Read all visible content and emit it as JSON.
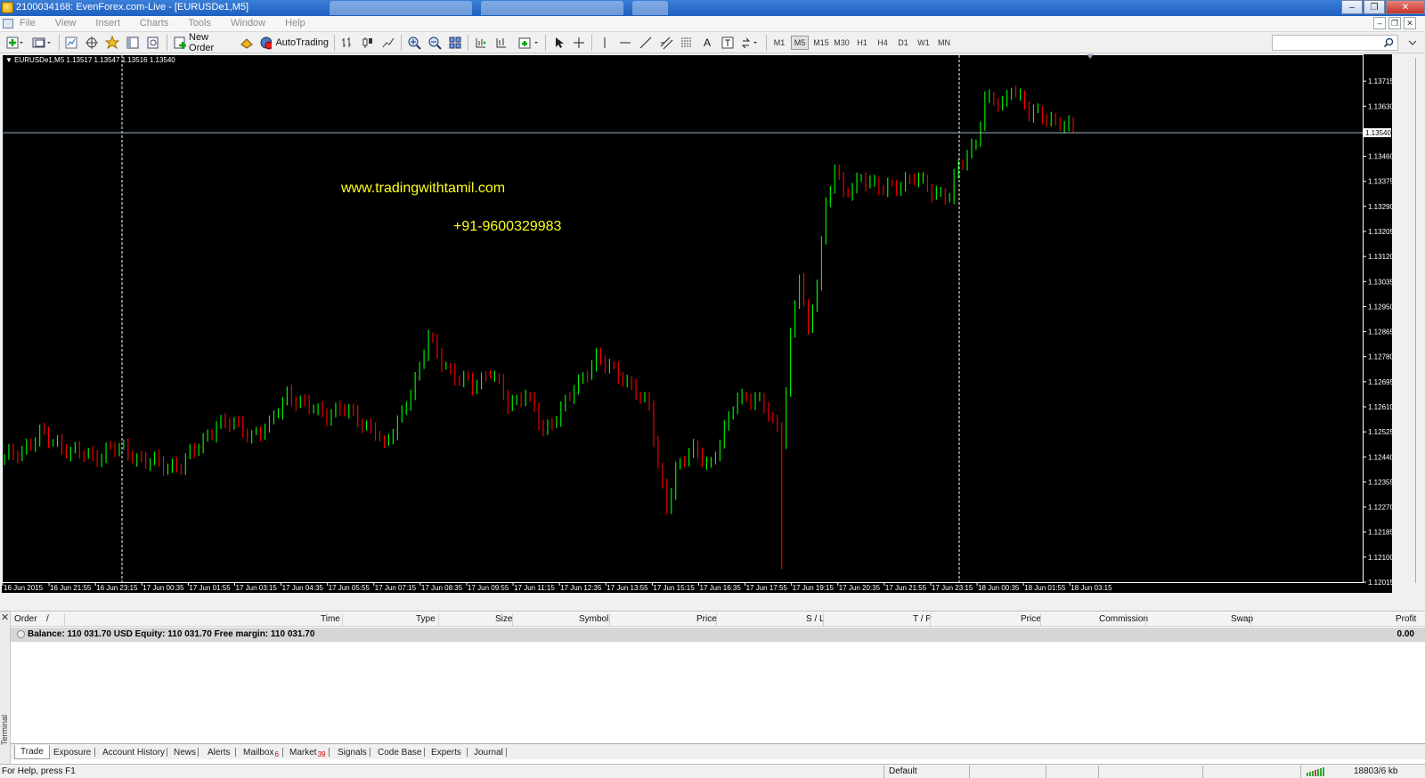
{
  "window": {
    "title": "2100034168: EvenForex.com-Live - [EURUSDe1,M5]"
  },
  "menu": [
    "File",
    "View",
    "Insert",
    "Charts",
    "Tools",
    "Window",
    "Help"
  ],
  "toolbar": {
    "new_order_label": "New Order",
    "autotrading_label": "AutoTrading",
    "timeframes": [
      "M1",
      "M5",
      "M15",
      "M30",
      "H1",
      "H4",
      "D1",
      "W1",
      "MN"
    ],
    "active_timeframe": "M5"
  },
  "chart": {
    "header": "EURUSDe1,M5  1.13517 1.13547 1.13516 1.13540",
    "overlay_url": "www.tradingwithtamil.com",
    "overlay_phone": "+91-9600329983",
    "current_price_label": "1.13540",
    "colors": {
      "bull": "#00ff00",
      "bear": "#ff0000",
      "background": "#000000"
    }
  },
  "chart_data": {
    "type": "candlestick",
    "symbol": "EURUSDe1",
    "timeframe": "M5",
    "ylim": [
      1.12015,
      1.138
    ],
    "y_ticks": [
      "1.13715",
      "1.13630",
      "1.13460",
      "1.13375",
      "1.13290",
      "1.13205",
      "1.13120",
      "1.13035",
      "1.12950",
      "1.12865",
      "1.12780",
      "1.12695",
      "1.12610",
      "1.12525",
      "1.12440",
      "1.12355",
      "1.12270",
      "1.12185",
      "1.12100",
      "1.12015"
    ],
    "x_ticks": [
      "16 Jun 2015",
      "16 Jun 21:55",
      "16 Jun 23:15",
      "17 Jun 00:35",
      "17 Jun 01:55",
      "17 Jun 03:15",
      "17 Jun 04:35",
      "17 Jun 05:55",
      "17 Jun 07:15",
      "17 Jun 08:35",
      "17 Jun 09:55",
      "17 Jun 11:15",
      "17 Jun 12:35",
      "17 Jun 13:55",
      "17 Jun 15:15",
      "17 Jun 16:35",
      "17 Jun 17:55",
      "17 Jun 19:15",
      "17 Jun 20:35",
      "17 Jun 21:55",
      "17 Jun 23:15",
      "18 Jun 00:35",
      "18 Jun 01:55",
      "18 Jun 03:15"
    ],
    "current_price": 1.1354,
    "close_path": [
      [
        0,
        1.1243
      ],
      [
        4,
        1.1247
      ],
      [
        8,
        1.1251
      ],
      [
        12,
        1.1249
      ],
      [
        16,
        1.1245
      ],
      [
        20,
        1.1244
      ],
      [
        24,
        1.1247
      ],
      [
        28,
        1.12455
      ],
      [
        32,
        1.1243
      ],
      [
        36,
        1.12405
      ],
      [
        40,
        1.1242
      ],
      [
        44,
        1.1247
      ],
      [
        48,
        1.1256
      ],
      [
        52,
        1.12545
      ],
      [
        56,
        1.1252
      ],
      [
        60,
        1.1254
      ],
      [
        64,
        1.1266
      ],
      [
        68,
        1.1261
      ],
      [
        72,
        1.1259
      ],
      [
        76,
        1.126
      ],
      [
        80,
        1.1257
      ],
      [
        84,
        1.1253
      ],
      [
        86,
        1.1246
      ],
      [
        90,
        1.126
      ],
      [
        94,
        1.1273
      ],
      [
        96,
        1.1285
      ],
      [
        98,
        1.128
      ],
      [
        102,
        1.127
      ],
      [
        106,
        1.1269
      ],
      [
        110,
        1.1273
      ],
      [
        114,
        1.1262
      ],
      [
        118,
        1.1266
      ],
      [
        122,
        1.1252
      ],
      [
        126,
        1.1261
      ],
      [
        130,
        1.1268
      ],
      [
        134,
        1.1279
      ],
      [
        138,
        1.1272
      ],
      [
        142,
        1.1269
      ],
      [
        146,
        1.126
      ],
      [
        148,
        1.124
      ],
      [
        150,
        1.1228
      ],
      [
        152,
        1.124
      ],
      [
        156,
        1.1246
      ],
      [
        160,
        1.1242
      ],
      [
        164,
        1.1256
      ],
      [
        166,
        1.1265
      ],
      [
        170,
        1.1264
      ],
      [
        174,
        1.1256
      ],
      [
        176,
        1.1251
      ],
      [
        178,
        1.1285
      ],
      [
        180,
        1.1305
      ],
      [
        182,
        1.1285
      ],
      [
        184,
        1.1305
      ],
      [
        186,
        1.133
      ],
      [
        188,
        1.1342
      ],
      [
        190,
        1.1332
      ],
      [
        194,
        1.134
      ],
      [
        198,
        1.1334
      ],
      [
        202,
        1.1337
      ],
      [
        206,
        1.1338
      ],
      [
        210,
        1.1335
      ],
      [
        214,
        1.1332
      ],
      [
        216,
        1.1342
      ],
      [
        220,
        1.1352
      ],
      [
        222,
        1.1365
      ],
      [
        226,
        1.1363
      ],
      [
        228,
        1.1371
      ],
      [
        232,
        1.136
      ],
      [
        236,
        1.136
      ],
      [
        240,
        1.1356
      ],
      [
        242,
        1.1354
      ]
    ],
    "spike_low": {
      "bar": 176,
      "value": 1.1206
    },
    "candles_count": 243
  },
  "terminal": {
    "columns": [
      "Order",
      "/",
      "Time",
      "Type",
      "Size",
      "Symbol",
      "Price",
      "S / L",
      "T / P",
      "Price",
      "Commission",
      "Swap",
      "Profit"
    ],
    "balance_text": "Balance: 110 031.70 USD   Equity: 110 031.70   Free margin: 110 031.70",
    "profit": "0.00",
    "side_label": "Terminal",
    "tabs": [
      {
        "label": "Trade",
        "badge": ""
      },
      {
        "label": "Exposure",
        "badge": ""
      },
      {
        "label": "Account History",
        "badge": ""
      },
      {
        "label": "News",
        "badge": ""
      },
      {
        "label": "Alerts",
        "badge": ""
      },
      {
        "label": "Mailbox",
        "badge": "6"
      },
      {
        "label": "Market",
        "badge": "39"
      },
      {
        "label": "Signals",
        "badge": ""
      },
      {
        "label": "Code Base",
        "badge": ""
      },
      {
        "label": "Experts",
        "badge": ""
      },
      {
        "label": "Journal",
        "badge": ""
      }
    ],
    "active_tab": "Trade"
  },
  "statusbar": {
    "help": "For Help, press F1",
    "profile": "Default",
    "traffic": "18803/6 kb"
  }
}
